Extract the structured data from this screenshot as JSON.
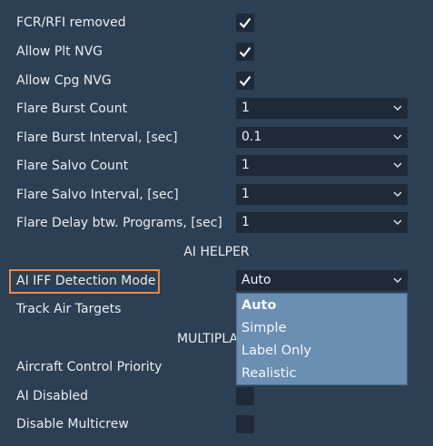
{
  "settings": [
    {
      "label": "FCR/RFI removed",
      "type": "checkbox",
      "checked": true
    },
    {
      "label": "Allow Plt NVG",
      "type": "checkbox",
      "checked": true
    },
    {
      "label": "Allow Cpg NVG",
      "type": "checkbox",
      "checked": true
    },
    {
      "label": "Flare Burst Count",
      "type": "select",
      "value": "1"
    },
    {
      "label": "Flare Burst Interval, [sec]",
      "type": "select",
      "value": "0.1"
    },
    {
      "label": "Flare Salvo Count",
      "type": "select",
      "value": "1"
    },
    {
      "label": "Flare Salvo Interval, [sec]",
      "type": "select",
      "value": "1"
    },
    {
      "label": "Flare Delay btw. Programs, [sec]",
      "type": "select",
      "value": "1"
    }
  ],
  "ai_helper": {
    "section_title": "AI HELPER",
    "iff_mode_label": "AI IFF Detection Mode",
    "iff_mode_value": "Auto",
    "track_air_label": "Track Air Targets",
    "dropdown_options": [
      "Auto",
      "Simple",
      "Label Only",
      "Realistic"
    ],
    "dropdown_selected": "Auto"
  },
  "multiplayer": {
    "section_title": "MULTIPLA",
    "aircraft_control_label": "Aircraft Control Priority",
    "ai_disabled_label": "AI Disabled",
    "ai_disabled_checked": false,
    "disable_multicrew_label": "Disable Multicrew",
    "disable_multicrew_checked": false
  },
  "colors": {
    "background": "#2d3f52",
    "control_bg": "#1e2a38",
    "highlight": "#e8894a",
    "dropdown_bg": "#6b8eb3"
  }
}
